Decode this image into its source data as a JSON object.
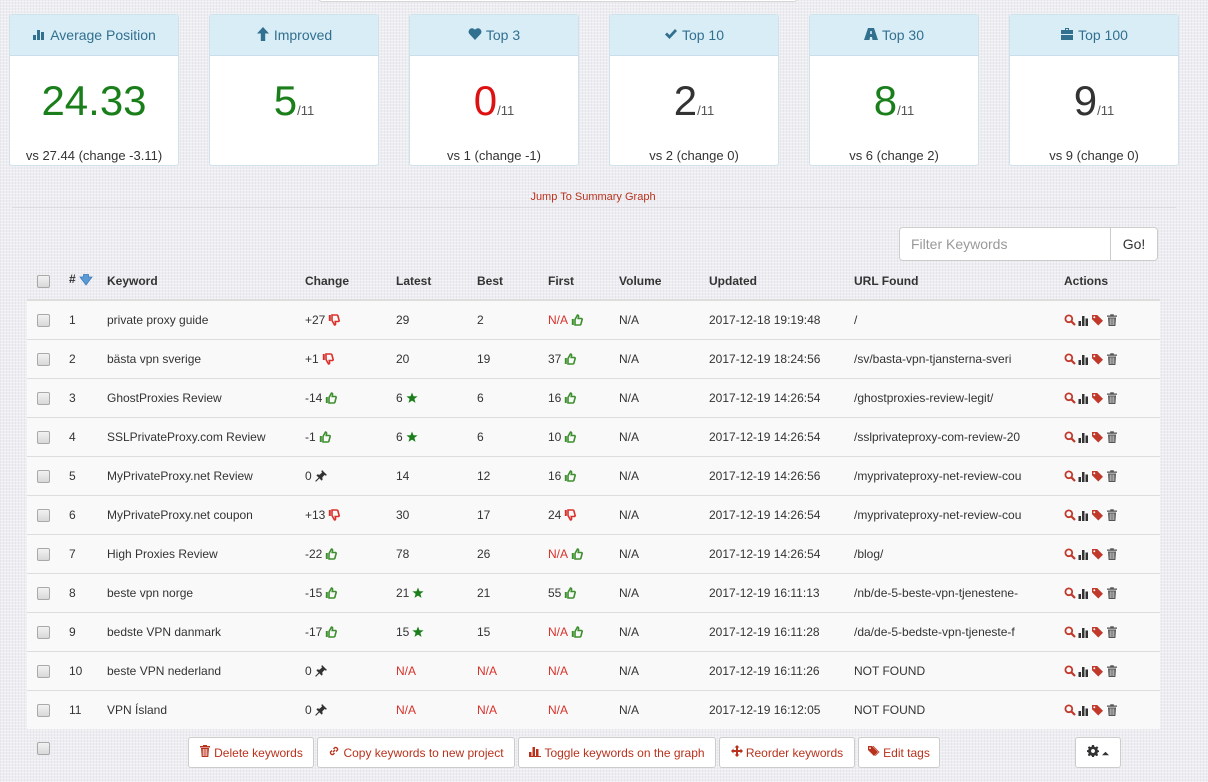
{
  "stats": [
    {
      "icon": "bar-chart-icon",
      "title": "Average Position",
      "value": "24.33",
      "of": "",
      "color": "#1a7f1a",
      "footer": "vs 27.44 (change -3.11)"
    },
    {
      "icon": "arrow-up-icon",
      "title": "Improved",
      "value": "5",
      "of": "/11",
      "color": "#1a7f1a",
      "footer": ""
    },
    {
      "icon": "heart-icon",
      "title": "Top 3",
      "value": "0",
      "of": "/11",
      "color": "#dd1111",
      "footer": "vs 1 (change -1)"
    },
    {
      "icon": "check-icon",
      "title": "Top 10",
      "value": "2",
      "of": "/11",
      "color": "#333333",
      "footer": "vs 2 (change 0)"
    },
    {
      "icon": "road-icon",
      "title": "Top 30",
      "value": "8",
      "of": "/11",
      "color": "#1a7f1a",
      "footer": "vs 6 (change 2)"
    },
    {
      "icon": "briefcase-icon",
      "title": "Top 100",
      "value": "9",
      "of": "/11",
      "color": "#333333",
      "footer": "vs 9 (change 0)"
    }
  ],
  "jump_link": "Jump To Summary Graph",
  "filter": {
    "placeholder": "Filter Keywords",
    "value": "",
    "button": "Go!"
  },
  "table": {
    "headers": {
      "num": "#",
      "keyword": "Keyword",
      "change": "Change",
      "latest": "Latest",
      "best": "Best",
      "first": "First",
      "volume": "Volume",
      "updated": "Updated",
      "url": "URL Found",
      "actions": "Actions"
    },
    "rows": [
      {
        "num": "1",
        "keyword": "private proxy guide",
        "change": "+27",
        "change_icon": "thumbs-down",
        "latest": "29",
        "latest_star": false,
        "best": "2",
        "first": "N/A",
        "first_icon": "thumbs-up",
        "volume": "N/A",
        "updated": "2017-12-18 19:19:48",
        "url": "/"
      },
      {
        "num": "2",
        "keyword": "bästa vpn sverige",
        "change": "+1",
        "change_icon": "thumbs-down",
        "latest": "20",
        "latest_star": false,
        "best": "19",
        "first": "37",
        "first_icon": "thumbs-up",
        "volume": "N/A",
        "updated": "2017-12-19 18:24:56",
        "url": "/sv/basta-vpn-tjansterna-sveri"
      },
      {
        "num": "3",
        "keyword": "GhostProxies Review",
        "change": "-14",
        "change_icon": "thumbs-up",
        "latest": "6",
        "latest_star": true,
        "best": "6",
        "first": "16",
        "first_icon": "thumbs-up",
        "volume": "N/A",
        "updated": "2017-12-19 14:26:54",
        "url": "/ghostproxies-review-legit/"
      },
      {
        "num": "4",
        "keyword": "SSLPrivateProxy.com Review",
        "change": "-1",
        "change_icon": "thumbs-up",
        "latest": "6",
        "latest_star": true,
        "best": "6",
        "first": "10",
        "first_icon": "thumbs-up",
        "volume": "N/A",
        "updated": "2017-12-19 14:26:54",
        "url": "/sslprivateproxy-com-review-20"
      },
      {
        "num": "5",
        "keyword": "MyPrivateProxy.net Review",
        "change": "0",
        "change_icon": "pin",
        "latest": "14",
        "latest_star": false,
        "best": "12",
        "first": "16",
        "first_icon": "thumbs-up",
        "volume": "N/A",
        "updated": "2017-12-19 14:26:56",
        "url": "/myprivateproxy-net-review-cou"
      },
      {
        "num": "6",
        "keyword": "MyPrivateProxy.net coupon",
        "change": "+13",
        "change_icon": "thumbs-down",
        "latest": "30",
        "latest_star": false,
        "best": "17",
        "first": "24",
        "first_icon": "thumbs-down",
        "volume": "N/A",
        "updated": "2017-12-19 14:26:54",
        "url": "/myprivateproxy-net-review-cou"
      },
      {
        "num": "7",
        "keyword": "High Proxies Review",
        "change": "-22",
        "change_icon": "thumbs-up",
        "latest": "78",
        "latest_star": false,
        "best": "26",
        "first": "N/A",
        "first_icon": "thumbs-up",
        "volume": "N/A",
        "updated": "2017-12-19 14:26:54",
        "url": "/blog/"
      },
      {
        "num": "8",
        "keyword": "beste vpn norge",
        "change": "-15",
        "change_icon": "thumbs-up",
        "latest": "21",
        "latest_star": true,
        "best": "21",
        "first": "55",
        "first_icon": "thumbs-up",
        "volume": "N/A",
        "updated": "2017-12-19 16:11:13",
        "url": "/nb/de-5-beste-vpn-tjenestene-"
      },
      {
        "num": "9",
        "keyword": "bedste VPN danmark",
        "change": "-17",
        "change_icon": "thumbs-up",
        "latest": "15",
        "latest_star": true,
        "best": "15",
        "first": "N/A",
        "first_icon": "thumbs-up",
        "volume": "N/A",
        "updated": "2017-12-19 16:11:28",
        "url": "/da/de-5-bedste-vpn-tjeneste-f"
      },
      {
        "num": "10",
        "keyword": "beste VPN nederland",
        "change": "0",
        "change_icon": "pin",
        "latest": "N/A",
        "latest_star": false,
        "best": "N/A",
        "first": "N/A",
        "first_icon": "",
        "volume": "N/A",
        "updated": "2017-12-19 16:11:26",
        "url": "NOT FOUND"
      },
      {
        "num": "11",
        "keyword": "VPN Ísland",
        "change": "0",
        "change_icon": "pin",
        "latest": "N/A",
        "latest_star": false,
        "best": "N/A",
        "first": "N/A",
        "first_icon": "",
        "volume": "N/A",
        "updated": "2017-12-19 16:12:05",
        "url": "NOT FOUND"
      }
    ]
  },
  "buttons": {
    "delete": "Delete keywords",
    "copy": "Copy keywords to new project",
    "toggle": "Toggle keywords on the graph",
    "reorder": "Reorder keywords",
    "edit_tags": "Edit tags"
  },
  "colors": {
    "accent": "#b8321d",
    "header_bg": "#d9edf7",
    "header_text": "#31708f",
    "good": "#1a7f1a",
    "bad": "#dd1111"
  }
}
